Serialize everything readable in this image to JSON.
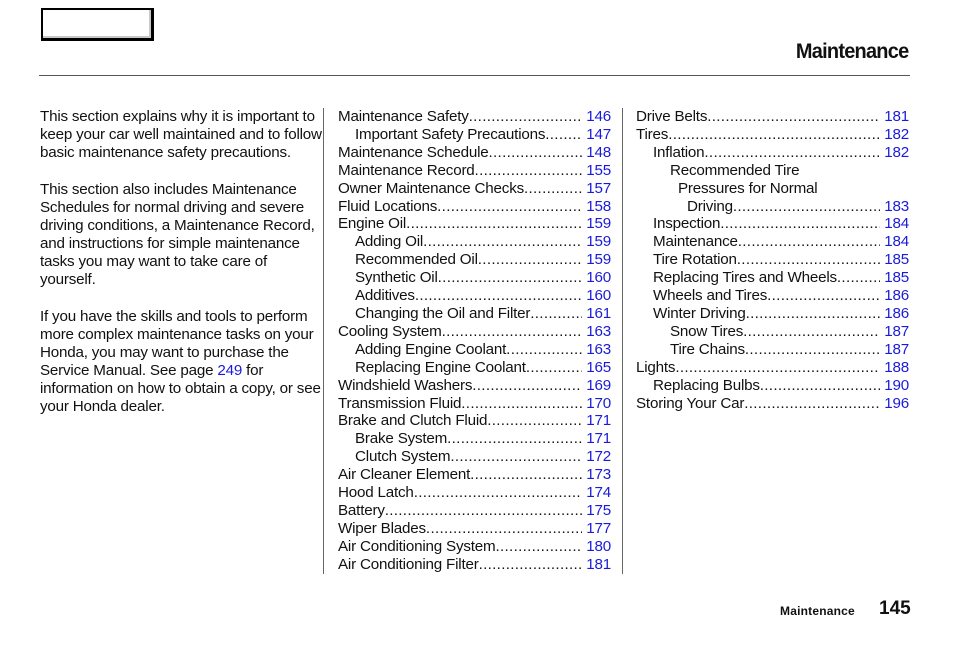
{
  "header": {
    "title": "Maintenance"
  },
  "intro": {
    "paragraphs": [
      "This section explains why it is important to keep your car well maintained and to follow basic maintenance safety precautions.",
      "This section also includes Maintenance Schedules for normal driving and severe driving conditions, a Maintenance Record, and instructions for simple maintenance tasks you may want to take care of yourself."
    ],
    "para3_before": "If you have the skills and tools to perform more complex maintenance tasks on your Honda, you may want to purchase the Service Manual. See page ",
    "para3_link": "249",
    "para3_after": " for information on how to obtain a copy, or see your Honda dealer."
  },
  "toc": {
    "column1": [
      {
        "label": "Maintenance Safety",
        "page": "146",
        "level": 0
      },
      {
        "label": "Important Safety Precautions",
        "page": "147",
        "level": 1
      },
      {
        "label": "Maintenance Schedule",
        "page": "148",
        "level": 0
      },
      {
        "label": "Maintenance Record",
        "page": "155",
        "level": 0
      },
      {
        "label": "Owner Maintenance Checks",
        "page": "157",
        "level": 0
      },
      {
        "label": "Fluid Locations",
        "page": "158",
        "level": 0
      },
      {
        "label": "Engine Oil",
        "page": "159",
        "level": 0
      },
      {
        "label": "Adding Oil",
        "page": "159",
        "level": 1
      },
      {
        "label": "Recommended Oil",
        "page": "159",
        "level": 1
      },
      {
        "label": "Synthetic Oil",
        "page": "160",
        "level": 1
      },
      {
        "label": "Additives",
        "page": "160",
        "level": 1
      },
      {
        "label": "Changing the Oil and Filter",
        "page": "161",
        "level": 1
      },
      {
        "label": "Cooling System",
        "page": "163",
        "level": 0
      },
      {
        "label": "Adding Engine Coolant",
        "page": "163",
        "level": 1
      },
      {
        "label": "Replacing Engine Coolant",
        "page": "165",
        "level": 1
      },
      {
        "label": "Windshield Washers",
        "page": "169",
        "level": 0
      },
      {
        "label": "Transmission Fluid",
        "page": "170",
        "level": 0
      },
      {
        "label": "Brake and Clutch Fluid",
        "page": "171",
        "level": 0
      },
      {
        "label": "Brake System",
        "page": "171",
        "level": 1
      },
      {
        "label": "Clutch System",
        "page": "172",
        "level": 1
      },
      {
        "label": "Air Cleaner Element",
        "page": "173",
        "level": 0
      },
      {
        "label": "Hood Latch",
        "page": "174",
        "level": 0
      },
      {
        "label": "Battery",
        "page": "175",
        "level": 0
      },
      {
        "label": "Wiper Blades",
        "page": "177",
        "level": 0
      },
      {
        "label": "Air Conditioning System",
        "page": "180",
        "level": 0
      },
      {
        "label": "Air Conditioning Filter",
        "page": "181",
        "level": 0
      }
    ],
    "column2": [
      {
        "label": "Drive Belts",
        "page": "181",
        "level": 0
      },
      {
        "label": "Tires",
        "page": "182",
        "level": 0
      },
      {
        "label": "Inflation",
        "page": "182",
        "level": 1
      },
      {
        "label": "Recommended Tire",
        "page": "",
        "level": 2
      },
      {
        "label": "Pressures for Normal",
        "page": "",
        "level": 3
      },
      {
        "label": "Driving",
        "page": "183",
        "level": 4
      },
      {
        "label": "Inspection",
        "page": "184",
        "level": 1
      },
      {
        "label": "Maintenance",
        "page": "184",
        "level": 1
      },
      {
        "label": "Tire Rotation",
        "page": "185",
        "level": 1
      },
      {
        "label": "Replacing Tires and Wheels",
        "page": "185",
        "level": 1
      },
      {
        "label": "Wheels and Tires",
        "page": "186",
        "level": 1
      },
      {
        "label": "Winter Driving",
        "page": "186",
        "level": 1
      },
      {
        "label": "Snow Tires",
        "page": "187",
        "level": 2
      },
      {
        "label": "Tire Chains",
        "page": "187",
        "level": 2
      },
      {
        "label": "Lights",
        "page": "188",
        "level": 0
      },
      {
        "label": "Replacing Bulbs",
        "page": "190",
        "level": 1
      },
      {
        "label": "Storing Your Car",
        "page": "196",
        "level": 0
      }
    ]
  },
  "footer": {
    "section": "Maintenance",
    "page_number": "145"
  },
  "colors": {
    "link": "#1a1adc",
    "text": "#111111",
    "rule": "#555555"
  }
}
